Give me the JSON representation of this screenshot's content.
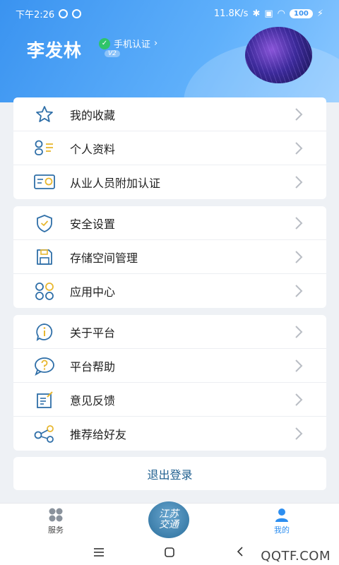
{
  "status_bar": {
    "time": "下午2:26",
    "speed": "11.8K/s",
    "battery": "100"
  },
  "profile": {
    "name": "李发林",
    "verify_label": "手机认证",
    "level_badge": "V2"
  },
  "menu_groups": [
    {
      "items": [
        {
          "label": "我的收藏",
          "icon": "star-icon"
        },
        {
          "label": "个人资料",
          "icon": "profile-list-icon"
        },
        {
          "label": "从业人员附加认证",
          "icon": "certificate-icon"
        }
      ]
    },
    {
      "items": [
        {
          "label": "安全设置",
          "icon": "shield-icon"
        },
        {
          "label": "存储空间管理",
          "icon": "floppy-disk-icon"
        },
        {
          "label": "应用中心",
          "icon": "app-grid-icon"
        }
      ]
    },
    {
      "items": [
        {
          "label": "关于平台",
          "icon": "info-icon"
        },
        {
          "label": "平台帮助",
          "icon": "help-icon"
        },
        {
          "label": "意见反馈",
          "icon": "feedback-icon"
        },
        {
          "label": "推荐给好友",
          "icon": "share-icon"
        }
      ]
    }
  ],
  "logout_label": "退出登录",
  "tabbar": {
    "service_label": "服务",
    "mine_label": "我的",
    "logo_text_top": "江苏",
    "logo_text_bottom": "交通"
  },
  "watermark": "QQTF.COM",
  "colors": {
    "header_blue": "#3a93f0",
    "accent_yellow": "#e8b730",
    "icon_blue": "#2f6fa8",
    "active_tab": "#2d8ef0"
  }
}
